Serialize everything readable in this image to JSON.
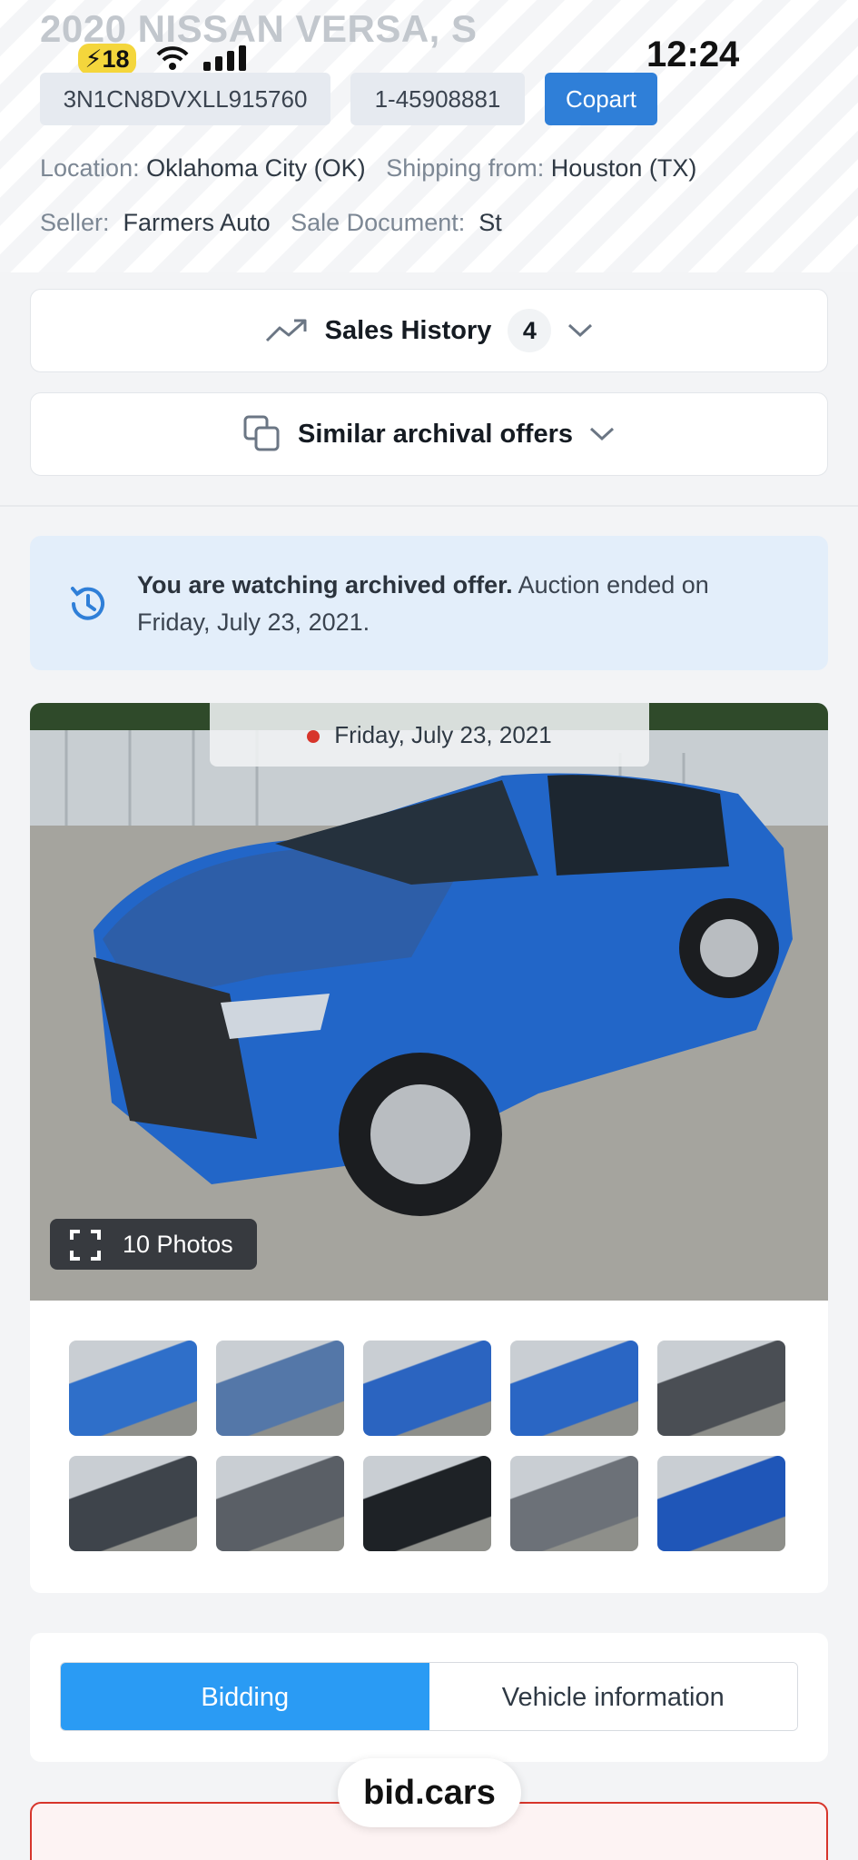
{
  "status_bar": {
    "battery": "18",
    "time": "12:24"
  },
  "vehicle": {
    "title": "2020 NISSAN VERSA, S",
    "vin": "3N1CN8DVXLL915760",
    "lot": "1-45908881",
    "auction": "Copart",
    "location_label": "Location:",
    "location_value": "Oklahoma City (OK)",
    "shipping_label": "Shipping from:",
    "shipping_value": "Houston (TX)",
    "seller_label": "Seller:",
    "seller_value": "Farmers Auto",
    "sale_doc_label": "Sale Document:",
    "sale_doc_value": "St"
  },
  "sales_history": {
    "label": "Sales History",
    "count": "4"
  },
  "similar": {
    "label": "Similar archival offers"
  },
  "notice": {
    "bold": "You are watching archived offer.",
    "rest": " Auction ended on Friday, July 23, 2021."
  },
  "gallery": {
    "date": "Friday, July 23, 2021",
    "photos_label": "10 Photos",
    "thumbnails": [
      {
        "name": "thumb-front-left",
        "color": "#2f6fc9"
      },
      {
        "name": "thumb-front-damage",
        "color": "#5477a8"
      },
      {
        "name": "thumb-rear-left",
        "color": "#2b64c0"
      },
      {
        "name": "thumb-rear-right",
        "color": "#2a66c4"
      },
      {
        "name": "thumb-interior-front",
        "color": "#4a4e54"
      },
      {
        "name": "thumb-interior-rear",
        "color": "#3e444b"
      },
      {
        "name": "thumb-engine",
        "color": "#5a5f66"
      },
      {
        "name": "thumb-odometer",
        "color": "#1e2226"
      },
      {
        "name": "thumb-front-bumper",
        "color": "#6c7178"
      },
      {
        "name": "thumb-vin-label",
        "color": "#1f56b8"
      }
    ]
  },
  "tabs": {
    "bidding": "Bidding",
    "vehicle_info": "Vehicle information"
  },
  "brand": "bid.cars",
  "colors": {
    "accent": "#2a9bf4",
    "copart": "#2f7fd8",
    "notice_bg": "#e3eefa",
    "alert": "#d7352b"
  }
}
